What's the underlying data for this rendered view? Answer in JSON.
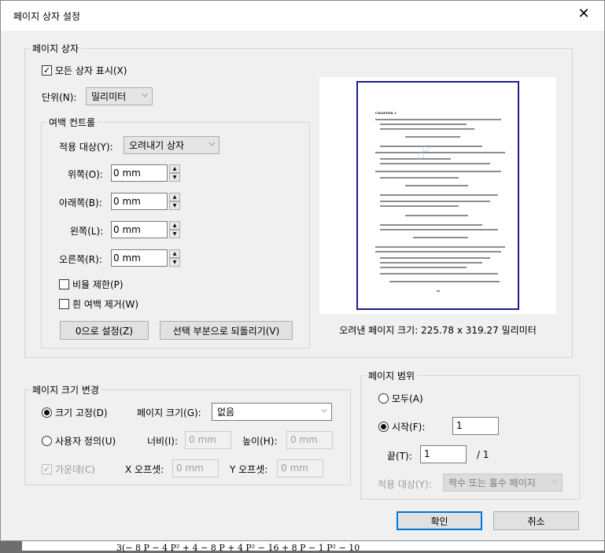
{
  "background": {
    "formula": "3(− 8 P − 4 P² + 4 − 8 P + 4 P² − 16 + 8 P − 1 P² − 10"
  },
  "dialog": {
    "title": "페이지 상자 설정",
    "close_glyph": "✕"
  },
  "page_box": {
    "legend": "페이지 상자",
    "show_all": {
      "label": "모든 상자 표시(X)",
      "checked": true
    },
    "unit": {
      "label": "단위(N):",
      "value": "밀리미터"
    }
  },
  "margin_control": {
    "legend": "여백 컨트롤",
    "apply_to": {
      "label": "적용 대상(Y):",
      "value": "오려내기 상자"
    },
    "top": {
      "label": "위쪽(O):",
      "value": "0 mm"
    },
    "bottom": {
      "label": "아래쪽(B):",
      "value": "0 mm"
    },
    "left": {
      "label": "왼쪽(L):",
      "value": "0 mm"
    },
    "right": {
      "label": "오른쪽(R):",
      "value": "0 mm"
    },
    "constrain_ratio": {
      "label": "비율 제한(P)",
      "checked": false
    },
    "remove_white": {
      "label": "흰 여백 제거(W)",
      "checked": false
    },
    "set_zero_button": "0으로 설정(Z)",
    "revert_button": "선택 부분으로 되돌리기(V)"
  },
  "preview": {
    "caption": "오려낸 페이지 크기: 225.78 x 319.27 밀리미터",
    "page_heading": "CHAPTER 1"
  },
  "page_size_change": {
    "legend": "페이지 크기 변경",
    "fixed_size": {
      "label": "크기 고정(D)",
      "selected": true
    },
    "page_size": {
      "label": "페이지 크기(G):",
      "value": "없음"
    },
    "custom": {
      "label": "사용자 정의(U)",
      "selected": false
    },
    "width": {
      "label": "너비(I):",
      "placeholder": "0 mm"
    },
    "height": {
      "label": "높이(H):",
      "placeholder": "0 mm"
    },
    "center": {
      "label": "가운데(C)",
      "checked": true
    },
    "x_offset": {
      "label": "X 오프셋:",
      "placeholder": "0 mm"
    },
    "y_offset": {
      "label": "Y 오프셋:",
      "placeholder": "0 mm"
    }
  },
  "page_range": {
    "legend": "페이지 범위",
    "all": {
      "label": "모두(A)",
      "selected": false
    },
    "from": {
      "label": "시작(F):",
      "value": "1",
      "selected": true
    },
    "to": {
      "label": "끝(T):",
      "value": "1",
      "total": "/ 1"
    },
    "apply_to": {
      "label": "적용 대상(Y):",
      "value": "짝수 또는 홀수 페이지"
    }
  },
  "ok_button": "확인",
  "cancel_button": "취소"
}
